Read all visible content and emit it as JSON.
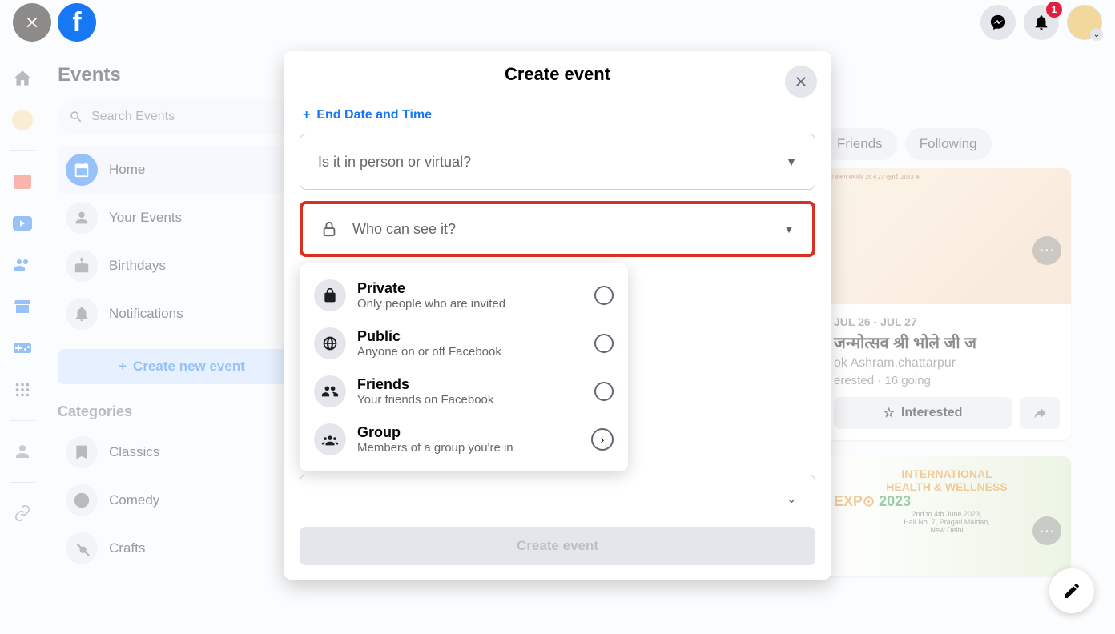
{
  "header": {
    "notifications_badge": "1"
  },
  "sidebar": {
    "title": "Events",
    "search_placeholder": "Search Events",
    "items": [
      {
        "label": "Home"
      },
      {
        "label": "Your Events"
      },
      {
        "label": "Birthdays"
      },
      {
        "label": "Notifications"
      }
    ],
    "create_button": "Create new event",
    "categories_title": "Categories",
    "categories": [
      {
        "label": "Classics"
      },
      {
        "label": "Comedy"
      },
      {
        "label": "Crafts"
      }
    ]
  },
  "filters": {
    "friends": "Friends",
    "following": "Following"
  },
  "event_card": {
    "date": "JUL 26 - JUL 27",
    "title": "जन्मोत्सव श्री भोले जी ज",
    "location": "ok Ashram,chattarpur",
    "meta": "erested · 16 going",
    "interested": "Interested"
  },
  "modal": {
    "title": "Create event",
    "end_date_label": "End Date and Time",
    "location_label": "Is it in person or virtual?",
    "privacy_label": "Who can see it?",
    "options": [
      {
        "title": "Private",
        "sub": "Only people who are invited"
      },
      {
        "title": "Public",
        "sub": "Anyone on or off Facebook"
      },
      {
        "title": "Friends",
        "sub": "Your friends on Facebook"
      },
      {
        "title": "Group",
        "sub": "Members of a group you're in"
      }
    ],
    "submit": "Create event"
  }
}
